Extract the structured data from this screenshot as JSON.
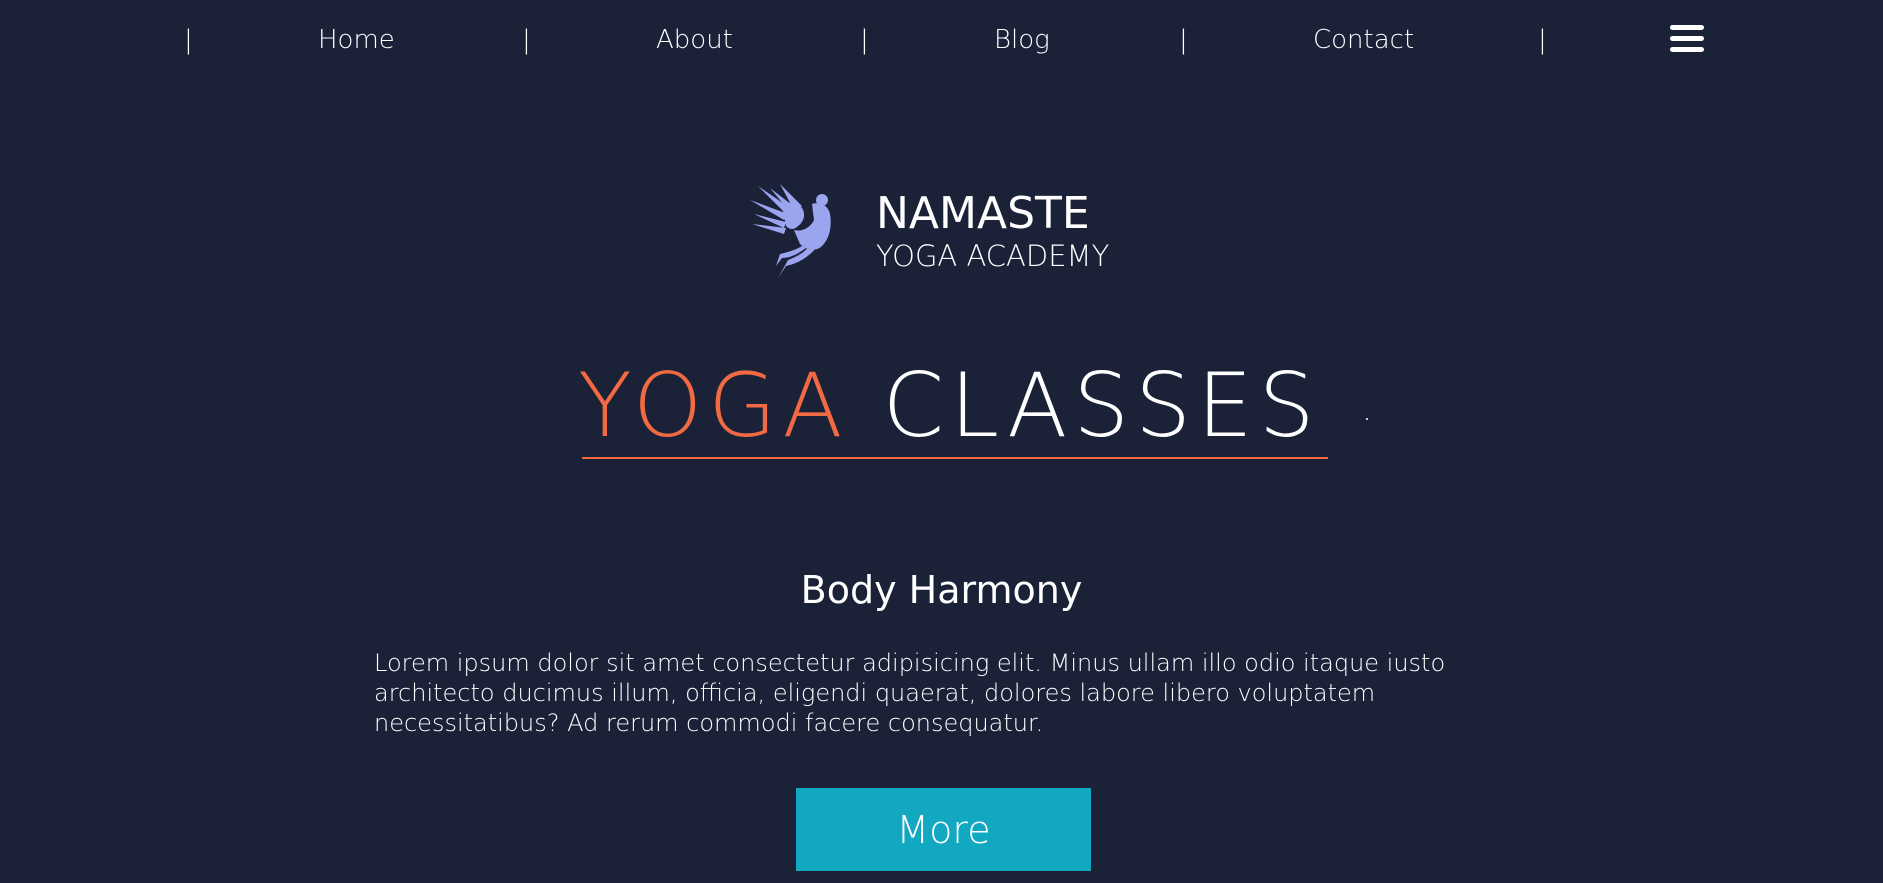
{
  "nav": {
    "items": [
      {
        "label": "Home"
      },
      {
        "label": "About"
      },
      {
        "label": "Blog"
      },
      {
        "label": "Contact"
      }
    ],
    "separator": "|",
    "menu_icon": "hamburger-menu-icon"
  },
  "logo": {
    "icon": "flying-figure-icon",
    "name": "NAMASTE",
    "subtitle": "YOGA ACADEMY",
    "icon_color": "#9ba4ef"
  },
  "hero": {
    "title_accent": "YOGA",
    "title_rest": "CLASSES"
  },
  "section": {
    "title": "Body Harmony",
    "body": "Lorem ipsum dolor sit amet consectetur adipisicing elit. Minus ullam illo odio itaque iusto architecto ducimus illum, officia, eligendi quaerat, dolores labore libero voluptatem necessitatibus? Ad rerum commodi facere consequatur.",
    "button_label": "More"
  },
  "colors": {
    "background": "#1b2238",
    "accent": "#f26a43",
    "button": "#12a8c2",
    "text": "#ffffff"
  }
}
